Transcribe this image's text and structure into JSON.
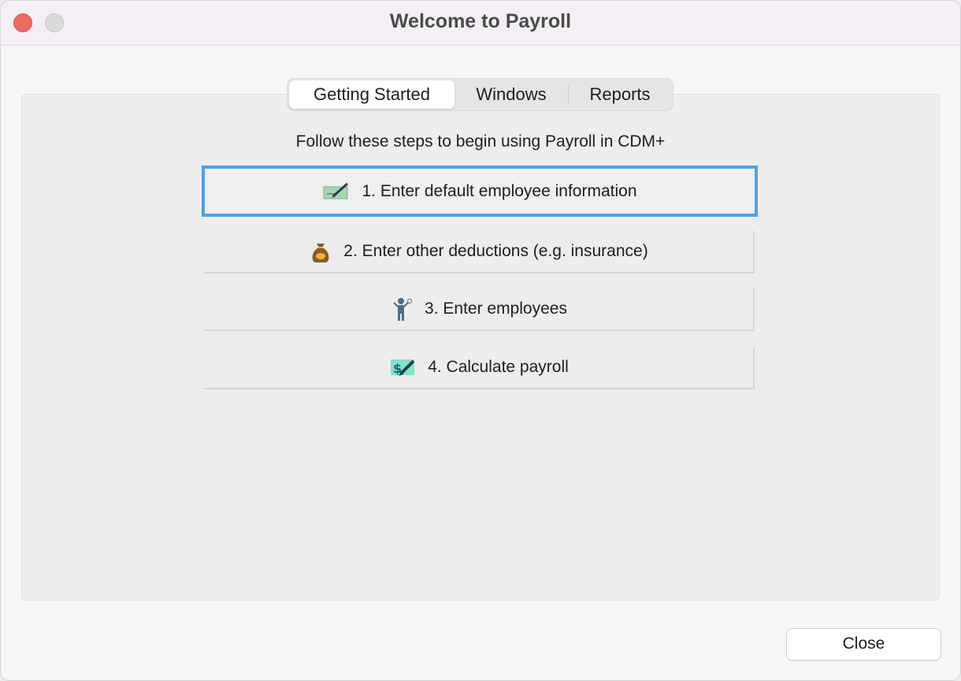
{
  "window": {
    "title": "Welcome to Payroll"
  },
  "tabs": [
    {
      "label": "Getting Started",
      "selected": true
    },
    {
      "label": "Windows",
      "selected": false
    },
    {
      "label": "Reports",
      "selected": false
    }
  ],
  "content": {
    "instructions": "Follow these steps to begin using Payroll in CDM+",
    "steps": [
      {
        "label": "1. Enter default employee information",
        "icon": "check-pen-icon",
        "focused": true
      },
      {
        "label": "2. Enter other deductions (e.g. insurance)",
        "icon": "money-bag-icon",
        "focused": false
      },
      {
        "label": "3. Enter employees",
        "icon": "employee-icon",
        "focused": false
      },
      {
        "label": "4. Calculate payroll",
        "icon": "calculate-payroll-icon",
        "focused": false
      }
    ]
  },
  "footer": {
    "close_label": "Close"
  },
  "colors": {
    "focus_ring": "#4f9fe8",
    "close_traffic_light": "#ee6a5f"
  }
}
